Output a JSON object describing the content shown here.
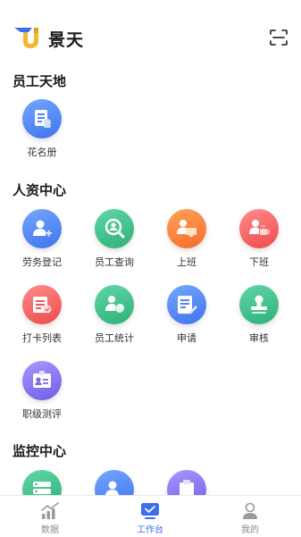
{
  "app": {
    "title": "景天"
  },
  "sections": [
    {
      "title": "员工天地",
      "items": [
        {
          "label": "花名册",
          "icon": "roster-icon"
        }
      ]
    },
    {
      "title": "人资中心",
      "items": [
        {
          "label": "劳务登记",
          "icon": "labor-register-icon"
        },
        {
          "label": "员工查询",
          "icon": "employee-search-icon"
        },
        {
          "label": "上班",
          "icon": "clock-in-icon"
        },
        {
          "label": "下班",
          "icon": "clock-out-icon"
        },
        {
          "label": "打卡列表",
          "icon": "punch-list-icon"
        },
        {
          "label": "员工统计",
          "icon": "employee-stats-icon"
        },
        {
          "label": "申请",
          "icon": "apply-icon"
        },
        {
          "label": "审核",
          "icon": "review-stamp-icon"
        },
        {
          "label": "职级测评",
          "icon": "rank-evaluation-icon"
        }
      ]
    },
    {
      "title": "监控中心",
      "items": []
    }
  ],
  "tabbar": {
    "items": [
      {
        "label": "数据",
        "icon": "chart-icon",
        "active": false
      },
      {
        "label": "工作台",
        "icon": "workbench-icon",
        "active": true
      },
      {
        "label": "我的",
        "icon": "profile-icon",
        "active": false
      }
    ]
  },
  "colors": {
    "accent": "#3a6df0",
    "blue": "#4f82f5",
    "green": "#35b982",
    "orange": "#f77a33",
    "red": "#f05757",
    "purple": "#7a68ec"
  }
}
